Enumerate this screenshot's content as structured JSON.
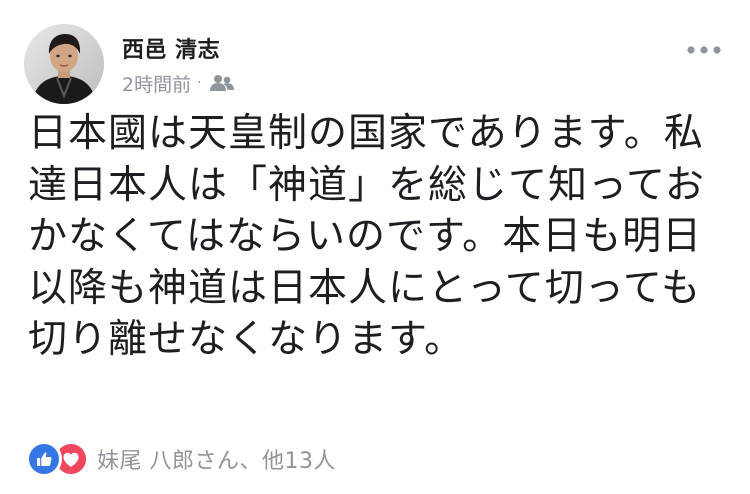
{
  "post": {
    "author_name": "西邑 清志",
    "timestamp": "2時間前",
    "separator": "·",
    "audience_icon": "friends-icon",
    "more_icon": "more-options-icon",
    "body": "日本國は天皇制の国家であります。私達日本人は「神道」を総じて知っておかなくてはならいのです。本日も明日以降も神道は日本人にとって切っても切り離せなくなります。",
    "reactions": {
      "like_icon": "like-icon",
      "love_icon": "love-icon",
      "summary": "妹尾 八郎さん、他13人"
    }
  },
  "colors": {
    "like": "#3578e5",
    "love": "#f0465e",
    "meta_text": "#90949c",
    "main_text": "#1c1e21"
  }
}
